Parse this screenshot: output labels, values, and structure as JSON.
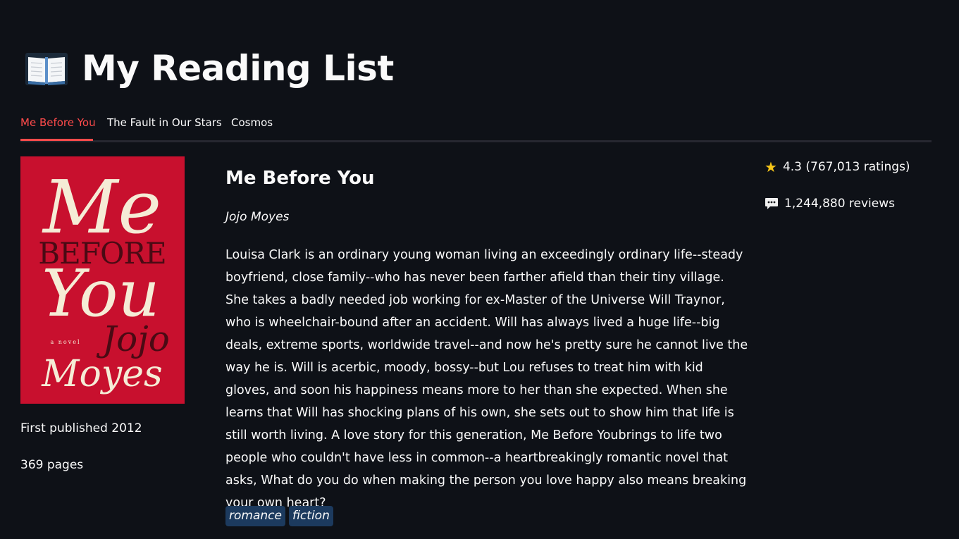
{
  "header": {
    "title": "My Reading List",
    "icon": "open-book-icon"
  },
  "tabs": [
    {
      "label": "Me Before You",
      "active": true
    },
    {
      "label": "The Fault in Our Stars",
      "active": false
    },
    {
      "label": "Cosmos",
      "active": false
    }
  ],
  "book": {
    "title": "Me Before You",
    "author": "Jojo Moyes",
    "first_published": "First published 2012",
    "pages": "369 pages",
    "description": "Louisa Clark is an ordinary young woman living an exceedingly ordinary life--steady boyfriend, close family--who has never been farther afield than their tiny village. She takes a badly needed job working for ex-Master of the Universe Will Traynor, who is wheelchair-bound after an accident. Will has always lived a huge life--big deals, extreme sports, worldwide travel--and now he's pretty sure he cannot live the way he is. Will is acerbic, moody, bossy--but Lou refuses to treat him with kid gloves, and soon his happiness means more to her than she expected. When she learns that Will has shocking plans of his own, she sets out to show him that life is still worth living. A love story for this generation, Me Before Youbrings to life two people who couldn't have less in common--a heartbreakingly romantic novel that asks, What do you do when making the person you love happy also means breaking your own heart?",
    "tags": [
      "romance",
      "fiction"
    ],
    "rating": "4.3 (767,013 ratings)",
    "reviews": "1,244,880 reviews",
    "cover": {
      "line1": "Me",
      "line2": "BEFORE",
      "line3": "You",
      "small": "a novel",
      "author_first": "Jojo",
      "author_last": "Moyes",
      "background": "#c8102e",
      "ink_light": "#f5ecd6",
      "ink_dark": "#4a0a14"
    }
  },
  "colors": {
    "background": "#0e1117",
    "accent": "#ff4b4b",
    "tag_bg": "#1c3a5e",
    "star": "#f5c518"
  }
}
